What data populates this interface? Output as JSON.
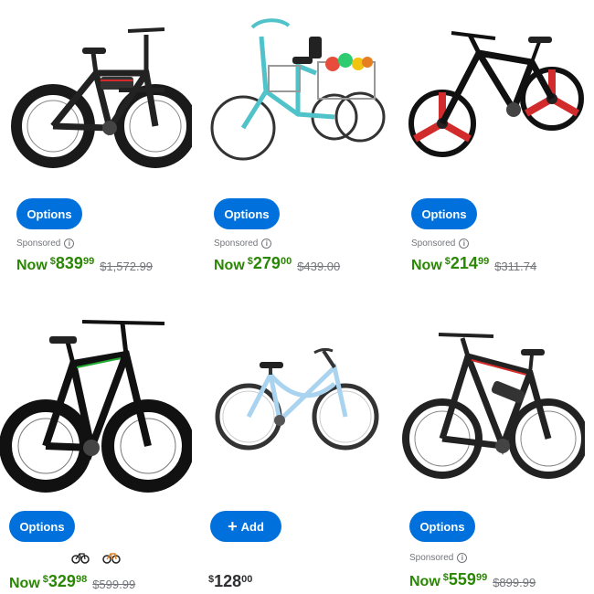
{
  "products": [
    {
      "name": "fat-tire-ebike-black",
      "button": "Options",
      "sponsored": "Sponsored",
      "now_label": "Now",
      "currency": "$",
      "dollars": "839",
      "cents": "99",
      "was": "$1,572.99"
    },
    {
      "name": "adult-tricycle-teal",
      "button": "Options",
      "sponsored": "Sponsored",
      "now_label": "Now",
      "currency": "$",
      "dollars": "279",
      "cents": "00",
      "was": "$439.00"
    },
    {
      "name": "folding-mountain-bike",
      "button": "Options",
      "sponsored": "Sponsored",
      "now_label": "Now",
      "currency": "$",
      "dollars": "214",
      "cents": "99",
      "was": "$311.74"
    },
    {
      "name": "fat-tire-mountain-bike-black-green",
      "button": "Options",
      "now_label": "Now",
      "currency": "$",
      "dollars": "329",
      "cents": "98",
      "was": "$599.99",
      "swatches": [
        "black",
        "orange"
      ]
    },
    {
      "name": "cruiser-bike-light-blue",
      "button": "Add",
      "button_icon": "plus-icon",
      "currency": "$",
      "dollars": "128",
      "cents": "00"
    },
    {
      "name": "electric-mountain-bike-black-red",
      "button": "Options",
      "sponsored": "Sponsored",
      "now_label": "Now",
      "currency": "$",
      "dollars": "559",
      "cents": "99",
      "was": "$899.99"
    }
  ],
  "colors": {
    "button_blue": "#0071dc",
    "price_green": "#2a8703",
    "muted_gray": "#74767c",
    "tricycle_teal": "#4fc3c9",
    "cruiser_blue": "#a9d3ee",
    "accent_red": "#d12b2b",
    "accent_green": "#22aa33"
  },
  "icons": {
    "info": "info-icon",
    "plus": "plus-icon"
  }
}
